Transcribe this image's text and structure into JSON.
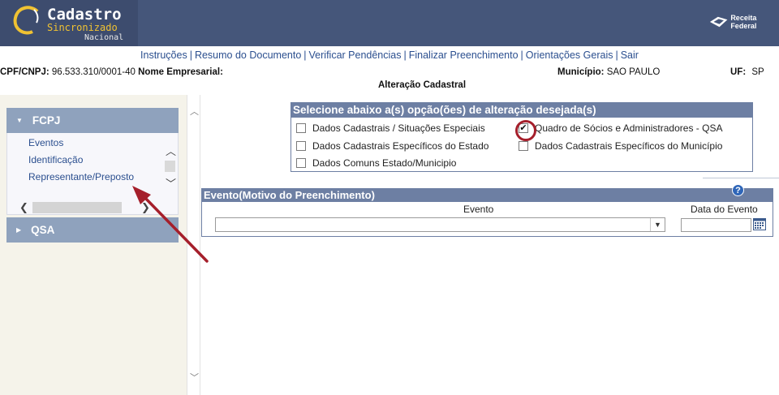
{
  "header": {
    "logo_title": "Cadastro",
    "logo_subtitle": "Sincronizado",
    "logo_nacional": "Nacional",
    "receita_label": "Receita Federal"
  },
  "topnav": {
    "items": [
      "Instruções",
      "Resumo do Documento",
      "Verificar Pendências",
      "Finalizar Preenchimento",
      "Orientações Gerais",
      "Sair"
    ],
    "separator": "|"
  },
  "info": {
    "cpf_label": "CPF/CNPJ:",
    "cpf_value": "96.533.310/0001-40",
    "nome_label": "Nome Empresarial:",
    "municipio_label": "Município:",
    "municipio_value": "SAO PAULO",
    "uf_label": "UF:",
    "uf_value": "SP",
    "subtitle": "Alteração Cadastral"
  },
  "sidebar": {
    "sections": [
      {
        "label": "FCPJ",
        "expanded": true,
        "items": [
          "Eventos",
          "Identificação",
          "Representante/Preposto"
        ]
      },
      {
        "label": "QSA",
        "expanded": false,
        "items": []
      }
    ]
  },
  "options": {
    "title": "Selecione abaixo a(s) opção(ões) de alteração desejada(s)",
    "items": [
      {
        "label": "Dados Cadastrais / Situações Especiais",
        "checked": false
      },
      {
        "label": "Quadro de Sócios e Administradores - QSA",
        "checked": true,
        "highlighted": true
      },
      {
        "label": "Dados Cadastrais Específicos do Estado",
        "checked": false
      },
      {
        "label": "Dados Cadastrais Específicos do Município",
        "checked": false
      },
      {
        "label": "Dados Comuns Estado/Municipio",
        "checked": false
      }
    ],
    "check_glyph": "✔"
  },
  "evento": {
    "title": "Evento(Motivo do Preenchimento)",
    "help_label": "?",
    "evento_label": "Evento",
    "evento_value": "",
    "data_label": "Data do Evento",
    "data_value": ""
  },
  "colors": {
    "header_bg": "#45567a",
    "section_header": "#6d7fa3",
    "accordion": "#8fa2bd",
    "link": "#2b4f8f",
    "logo_accent": "#f0c232",
    "highlight_red": "#a51f2b"
  },
  "icons": [
    "chevron-up-icon",
    "chevron-down-icon",
    "chevron-left-icon",
    "chevron-right-icon",
    "triangle-down-icon",
    "triangle-right-icon",
    "calendar-icon",
    "help-icon",
    "checkmark-icon"
  ]
}
